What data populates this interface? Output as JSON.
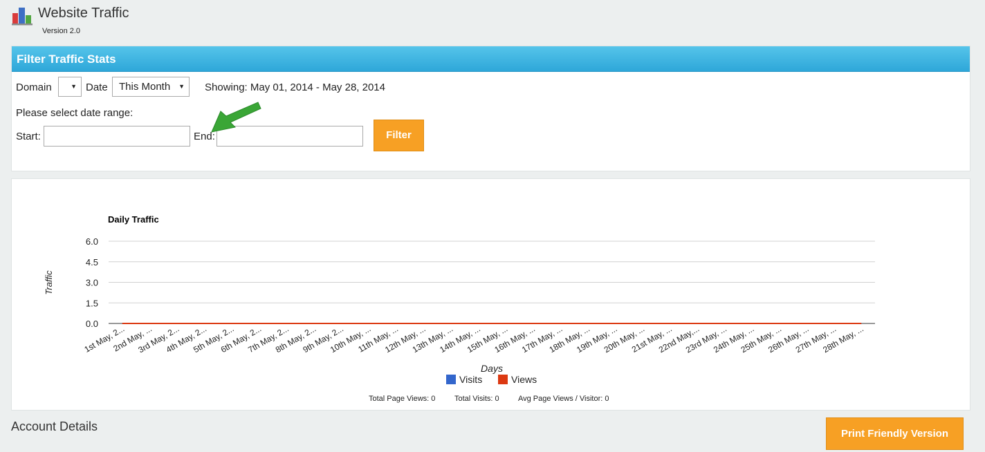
{
  "app": {
    "title": "Website Traffic",
    "version": "Version 2.0",
    "logo_icon": "bar-chart-logo-icon"
  },
  "filter": {
    "heading": "Filter Traffic Stats",
    "domain_label": "Domain",
    "domain_value": "",
    "date_label": "Date",
    "date_value": "This Month",
    "showing_text": "Showing: May 01, 2014 - May 28, 2014",
    "range_prompt": "Please select date range:",
    "start_label": "Start:",
    "start_value": "",
    "end_label": "End:",
    "end_value": "",
    "filter_button": "Filter"
  },
  "colors": {
    "header_blue": "#2ea7d9",
    "accent_orange": "#f7a024",
    "visits": "#3366cc",
    "views": "#dc3912"
  },
  "chart_data": {
    "type": "line",
    "title": "Daily Traffic",
    "xlabel": "Days",
    "ylabel": "Traffic",
    "ylim": [
      0,
      6.0
    ],
    "yticks": [
      "6.0",
      "4.5",
      "3.0",
      "1.5",
      "0.0"
    ],
    "grid": true,
    "legend": "bottom",
    "categories": [
      "1st May, 2...",
      "2nd May, ...",
      "3rd May, 2...",
      "4th May, 2...",
      "5th May, 2...",
      "6th May, 2...",
      "7th May, 2...",
      "8th May, 2...",
      "9th May, 2...",
      "10th May, ...",
      "11th May, ...",
      "12th May, ...",
      "13th May, ...",
      "14th May, ...",
      "15th May, ...",
      "16th May, ...",
      "17th May, ...",
      "18th May, ...",
      "19th May, ...",
      "20th May, ...",
      "21st May, ...",
      "22nd May,...",
      "23rd May, ...",
      "24th May, ...",
      "25th May, ...",
      "26th May, ...",
      "27th May, ...",
      "28th May, ..."
    ],
    "series": [
      {
        "name": "Visits",
        "color": "#3366cc",
        "values": [
          0,
          0,
          0,
          0,
          0,
          0,
          0,
          0,
          0,
          0,
          0,
          0,
          0,
          0,
          0,
          0,
          0,
          0,
          0,
          0,
          0,
          0,
          0,
          0,
          0,
          0,
          0,
          0
        ]
      },
      {
        "name": "Views",
        "color": "#dc3912",
        "values": [
          0,
          0,
          0,
          0,
          0,
          0,
          0,
          0,
          0,
          0,
          0,
          0,
          0,
          0,
          0,
          0,
          0,
          0,
          0,
          0,
          0,
          0,
          0,
          0,
          0,
          0,
          0,
          0
        ]
      }
    ]
  },
  "totals": {
    "page_views": "Total Page Views: 0",
    "visits": "Total Visits: 0",
    "avg": "Avg Page Views / Visitor: 0"
  },
  "account": {
    "title": "Account Details"
  },
  "print_button": "Print Friendly Version",
  "annotation": {
    "arrow_icon": "green-arrow-icon"
  }
}
